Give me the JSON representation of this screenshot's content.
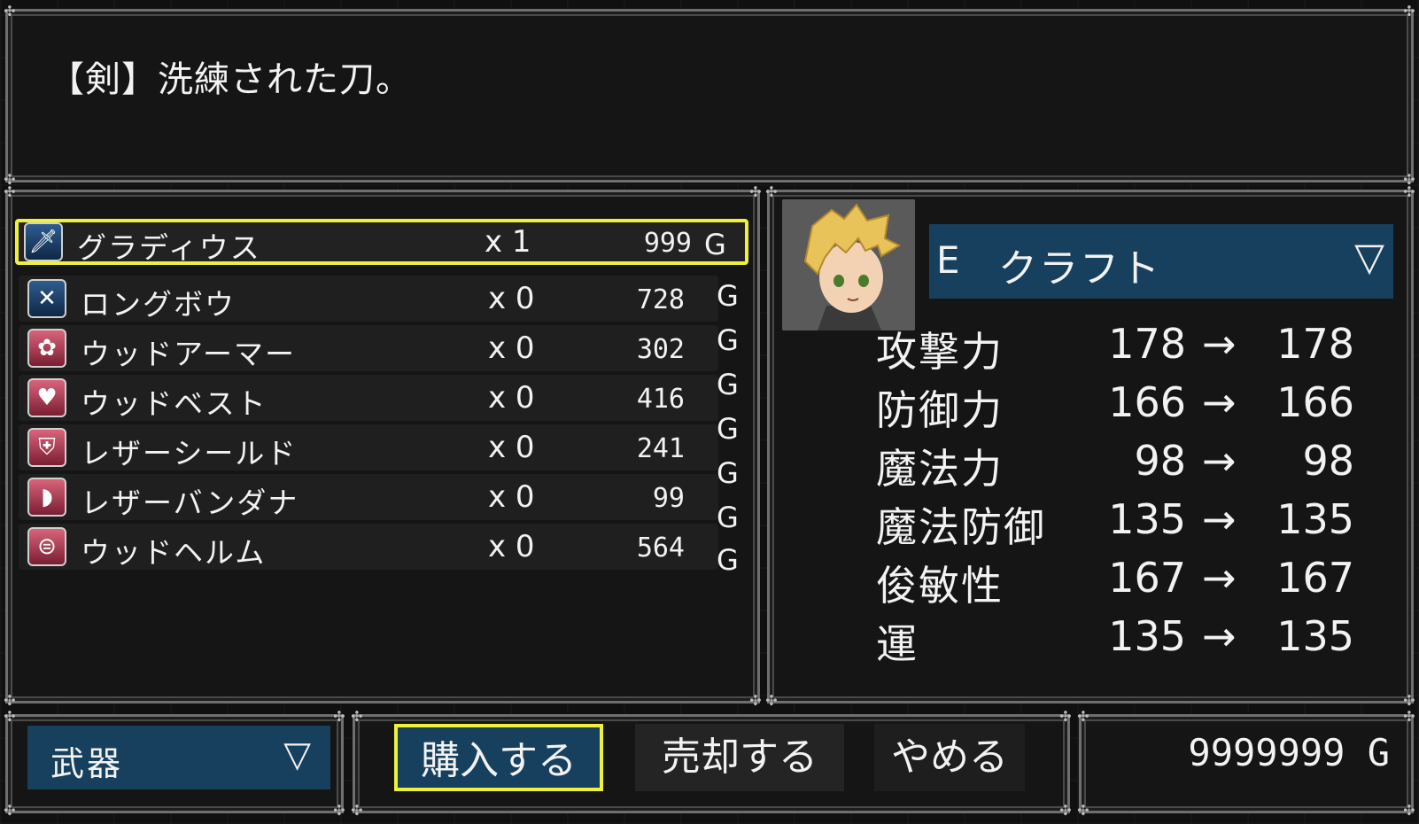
{
  "help": {
    "text": "【剣】洗練された刀。"
  },
  "items": [
    {
      "name": "グラディウス",
      "qty": "x 1",
      "price": "999",
      "icon": "sword-icon",
      "color": "blue"
    },
    {
      "name": "ロングボウ",
      "qty": "x 0",
      "price": "728",
      "icon": "bow-icon",
      "color": "blue"
    },
    {
      "name": "ウッドアーマー",
      "qty": "x 0",
      "price": "302",
      "icon": "armor-icon",
      "color": "red"
    },
    {
      "name": "ウッドベスト",
      "qty": "x 0",
      "price": "416",
      "icon": "vest-icon",
      "color": "red"
    },
    {
      "name": "レザーシールド",
      "qty": "x 0",
      "price": "241",
      "icon": "shield-icon",
      "color": "red"
    },
    {
      "name": "レザーバンダナ",
      "qty": "x 0",
      "price": "99",
      "icon": "bandana-icon",
      "color": "red"
    },
    {
      "name": "ウッドヘルム",
      "qty": "x 0",
      "price": "564",
      "icon": "helmet-icon",
      "color": "red"
    }
  ],
  "currency_unit": "G",
  "actor": {
    "equip_marker": "E",
    "name": "クラフト",
    "arrow": "▽"
  },
  "stats": [
    {
      "label": "攻撃力",
      "cur": "178",
      "arrow": "→",
      "new": "178"
    },
    {
      "label": "防御力",
      "cur": "166",
      "arrow": "→",
      "new": "166"
    },
    {
      "label": "魔法力",
      "cur": "98",
      "arrow": "→",
      "new": "98"
    },
    {
      "label": "魔法防御",
      "cur": "135",
      "arrow": "→",
      "new": "135"
    },
    {
      "label": "俊敏性",
      "cur": "167",
      "arrow": "→",
      "new": "167"
    },
    {
      "label": "運",
      "cur": "135",
      "arrow": "→",
      "new": "135"
    }
  ],
  "category": {
    "label": "武器",
    "arrow": "▽"
  },
  "commands": {
    "buy": "購入する",
    "sell": "売却する",
    "cancel": "やめる"
  },
  "gold": "9999999 G",
  "colors": {
    "highlight": "#eef03a",
    "accent_blue": "#17405e"
  }
}
